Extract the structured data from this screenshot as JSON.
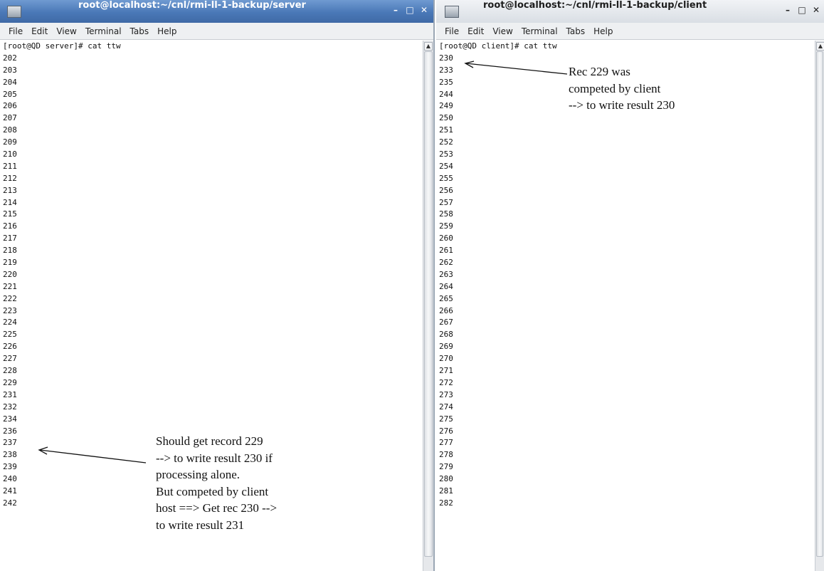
{
  "server_window": {
    "title": "root@localhost:~/cnl/rmi-ll-1-backup/server",
    "buttons": {
      "minimize": "–",
      "maximize": "□",
      "close": "✕"
    },
    "menu": [
      "File",
      "Edit",
      "View",
      "Terminal",
      "Tabs",
      "Help"
    ],
    "lines": [
      "[root@QD server]# cat ttw",
      "202",
      "203",
      "204",
      "205",
      "206",
      "207",
      "208",
      "209",
      "210",
      "211",
      "212",
      "213",
      "214",
      "215",
      "216",
      "217",
      "218",
      "219",
      "220",
      "221",
      "222",
      "223",
      "224",
      "225",
      "226",
      "227",
      "228",
      "229",
      "231",
      "232",
      "234",
      "236",
      "237",
      "238",
      "239",
      "240",
      "241",
      "242"
    ]
  },
  "client_window": {
    "title": "root@localhost:~/cnl/rmi-ll-1-backup/client",
    "buttons": {
      "minimize": "–",
      "maximize": "□",
      "close": "✕"
    },
    "menu": [
      "File",
      "Edit",
      "View",
      "Terminal",
      "Tabs",
      "Help"
    ],
    "lines": [
      "[root@QD client]# cat ttw",
      "230",
      "233",
      "235",
      "244",
      "249",
      "250",
      "251",
      "252",
      "253",
      "254",
      "255",
      "256",
      "257",
      "258",
      "259",
      "260",
      "261",
      "262",
      "263",
      "264",
      "265",
      "266",
      "267",
      "268",
      "269",
      "270",
      "271",
      "272",
      "273",
      "274",
      "275",
      "276",
      "277",
      "278",
      "279",
      "280",
      "281",
      "282"
    ]
  },
  "annotations": {
    "client": [
      "Rec 229 was",
      "competed by client",
      "--> to write result 230"
    ],
    "server": [
      "Should get record 229",
      "--> to write result 230 if",
      "processing alone.",
      "But competed by client",
      "host ==> Get rec 230 -->",
      "to write result 231"
    ]
  },
  "colors": {
    "active_titlebar": "#4a78b7",
    "inactive_titlebar": "#dfe3e8"
  }
}
